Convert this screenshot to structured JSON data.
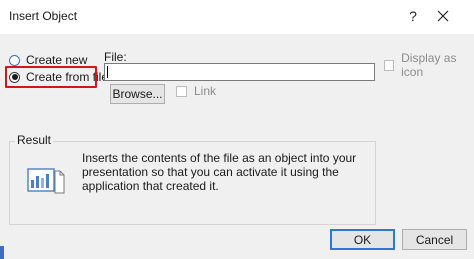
{
  "window": {
    "title": "Insert Object",
    "help_label": "?",
    "close_icon": "close-icon"
  },
  "options": {
    "create_new_label": "Create new",
    "create_from_file_label": "Create from file",
    "selected": "create_from_file"
  },
  "file": {
    "label": "File:",
    "value": "",
    "browse_label": "Browse...",
    "link_label": "Link",
    "link_checked": false
  },
  "display_as_icon": {
    "label": "Display as icon",
    "checked": false
  },
  "result": {
    "legend": "Result",
    "text": "Inserts the contents of the file as an object into your presentation so that you can activate it using the application that created it.",
    "icon": "document-chart-icon"
  },
  "buttons": {
    "ok_label": "OK",
    "cancel_label": "Cancel"
  },
  "colors": {
    "highlight": "#d6141b",
    "default_button_border": "#2d78d4"
  }
}
